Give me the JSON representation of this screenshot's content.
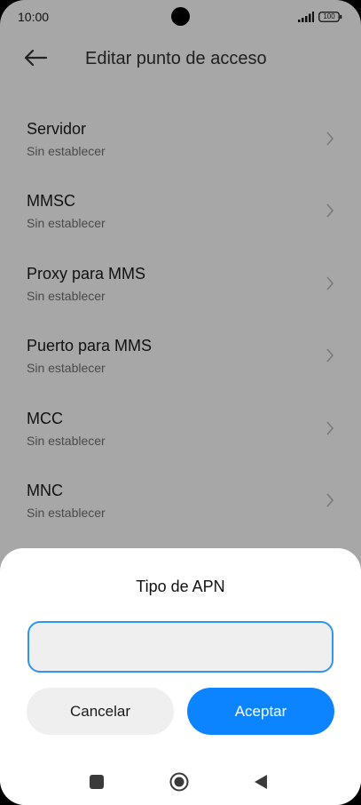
{
  "status_bar": {
    "time": "10:00",
    "battery": "100",
    "icons": [
      "signal-icon",
      "battery-icon"
    ]
  },
  "header": {
    "title": "Editar punto de acceso",
    "back_icon": "arrow-left-icon"
  },
  "settings": {
    "items": [
      {
        "title": "Servidor",
        "subtitle": "Sin establecer"
      },
      {
        "title": "MMSC",
        "subtitle": "Sin establecer"
      },
      {
        "title": "Proxy para MMS",
        "subtitle": "Sin establecer"
      },
      {
        "title": "Puerto para MMS",
        "subtitle": "Sin establecer"
      },
      {
        "title": "MCC",
        "subtitle": "Sin establecer"
      },
      {
        "title": "MNC",
        "subtitle": "Sin establecer"
      }
    ]
  },
  "dialog": {
    "title": "Tipo de APN",
    "input_value": "",
    "cancel_label": "Cancelar",
    "accept_label": "Aceptar"
  },
  "nav": {
    "icons": [
      "recents-square-icon",
      "home-circle-icon",
      "back-triangle-icon"
    ]
  },
  "colors": {
    "accent": "#0d84ff",
    "input_border": "#2f95f0",
    "dimmed_background": "#a7a7a7"
  }
}
